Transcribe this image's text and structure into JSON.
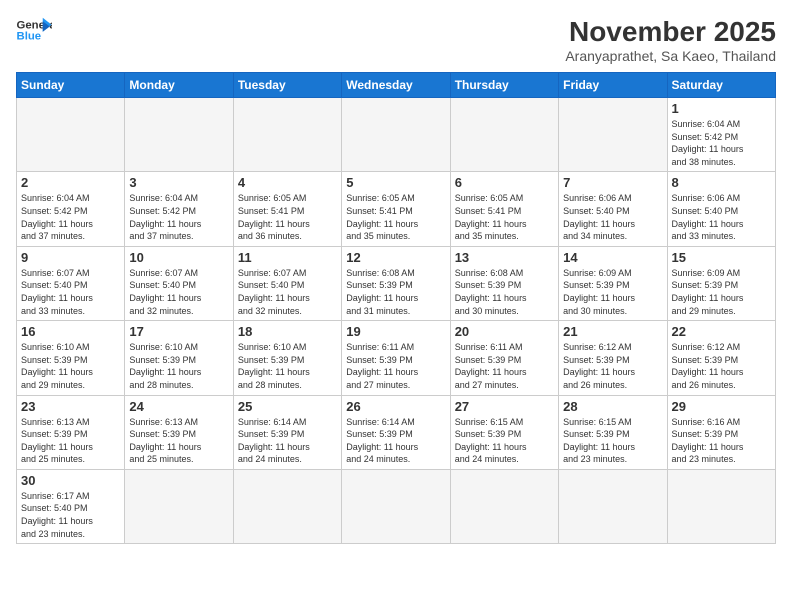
{
  "logo": {
    "line1": "General",
    "line2": "Blue"
  },
  "title": "November 2025",
  "subtitle": "Aranyaprathet, Sa Kaeo, Thailand",
  "weekdays": [
    "Sunday",
    "Monday",
    "Tuesday",
    "Wednesday",
    "Thursday",
    "Friday",
    "Saturday"
  ],
  "weeks": [
    [
      {
        "day": "",
        "info": ""
      },
      {
        "day": "",
        "info": ""
      },
      {
        "day": "",
        "info": ""
      },
      {
        "day": "",
        "info": ""
      },
      {
        "day": "",
        "info": ""
      },
      {
        "day": "",
        "info": ""
      },
      {
        "day": "1",
        "info": "Sunrise: 6:04 AM\nSunset: 5:42 PM\nDaylight: 11 hours\nand 38 minutes."
      }
    ],
    [
      {
        "day": "2",
        "info": "Sunrise: 6:04 AM\nSunset: 5:42 PM\nDaylight: 11 hours\nand 37 minutes."
      },
      {
        "day": "3",
        "info": "Sunrise: 6:04 AM\nSunset: 5:42 PM\nDaylight: 11 hours\nand 37 minutes."
      },
      {
        "day": "4",
        "info": "Sunrise: 6:05 AM\nSunset: 5:41 PM\nDaylight: 11 hours\nand 36 minutes."
      },
      {
        "day": "5",
        "info": "Sunrise: 6:05 AM\nSunset: 5:41 PM\nDaylight: 11 hours\nand 35 minutes."
      },
      {
        "day": "6",
        "info": "Sunrise: 6:05 AM\nSunset: 5:41 PM\nDaylight: 11 hours\nand 35 minutes."
      },
      {
        "day": "7",
        "info": "Sunrise: 6:06 AM\nSunset: 5:40 PM\nDaylight: 11 hours\nand 34 minutes."
      },
      {
        "day": "8",
        "info": "Sunrise: 6:06 AM\nSunset: 5:40 PM\nDaylight: 11 hours\nand 33 minutes."
      }
    ],
    [
      {
        "day": "9",
        "info": "Sunrise: 6:07 AM\nSunset: 5:40 PM\nDaylight: 11 hours\nand 33 minutes."
      },
      {
        "day": "10",
        "info": "Sunrise: 6:07 AM\nSunset: 5:40 PM\nDaylight: 11 hours\nand 32 minutes."
      },
      {
        "day": "11",
        "info": "Sunrise: 6:07 AM\nSunset: 5:40 PM\nDaylight: 11 hours\nand 32 minutes."
      },
      {
        "day": "12",
        "info": "Sunrise: 6:08 AM\nSunset: 5:39 PM\nDaylight: 11 hours\nand 31 minutes."
      },
      {
        "day": "13",
        "info": "Sunrise: 6:08 AM\nSunset: 5:39 PM\nDaylight: 11 hours\nand 30 minutes."
      },
      {
        "day": "14",
        "info": "Sunrise: 6:09 AM\nSunset: 5:39 PM\nDaylight: 11 hours\nand 30 minutes."
      },
      {
        "day": "15",
        "info": "Sunrise: 6:09 AM\nSunset: 5:39 PM\nDaylight: 11 hours\nand 29 minutes."
      }
    ],
    [
      {
        "day": "16",
        "info": "Sunrise: 6:10 AM\nSunset: 5:39 PM\nDaylight: 11 hours\nand 29 minutes."
      },
      {
        "day": "17",
        "info": "Sunrise: 6:10 AM\nSunset: 5:39 PM\nDaylight: 11 hours\nand 28 minutes."
      },
      {
        "day": "18",
        "info": "Sunrise: 6:10 AM\nSunset: 5:39 PM\nDaylight: 11 hours\nand 28 minutes."
      },
      {
        "day": "19",
        "info": "Sunrise: 6:11 AM\nSunset: 5:39 PM\nDaylight: 11 hours\nand 27 minutes."
      },
      {
        "day": "20",
        "info": "Sunrise: 6:11 AM\nSunset: 5:39 PM\nDaylight: 11 hours\nand 27 minutes."
      },
      {
        "day": "21",
        "info": "Sunrise: 6:12 AM\nSunset: 5:39 PM\nDaylight: 11 hours\nand 26 minutes."
      },
      {
        "day": "22",
        "info": "Sunrise: 6:12 AM\nSunset: 5:39 PM\nDaylight: 11 hours\nand 26 minutes."
      }
    ],
    [
      {
        "day": "23",
        "info": "Sunrise: 6:13 AM\nSunset: 5:39 PM\nDaylight: 11 hours\nand 25 minutes."
      },
      {
        "day": "24",
        "info": "Sunrise: 6:13 AM\nSunset: 5:39 PM\nDaylight: 11 hours\nand 25 minutes."
      },
      {
        "day": "25",
        "info": "Sunrise: 6:14 AM\nSunset: 5:39 PM\nDaylight: 11 hours\nand 24 minutes."
      },
      {
        "day": "26",
        "info": "Sunrise: 6:14 AM\nSunset: 5:39 PM\nDaylight: 11 hours\nand 24 minutes."
      },
      {
        "day": "27",
        "info": "Sunrise: 6:15 AM\nSunset: 5:39 PM\nDaylight: 11 hours\nand 24 minutes."
      },
      {
        "day": "28",
        "info": "Sunrise: 6:15 AM\nSunset: 5:39 PM\nDaylight: 11 hours\nand 23 minutes."
      },
      {
        "day": "29",
        "info": "Sunrise: 6:16 AM\nSunset: 5:39 PM\nDaylight: 11 hours\nand 23 minutes."
      }
    ],
    [
      {
        "day": "30",
        "info": "Sunrise: 6:17 AM\nSunset: 5:40 PM\nDaylight: 11 hours\nand 23 minutes."
      },
      {
        "day": "",
        "info": ""
      },
      {
        "day": "",
        "info": ""
      },
      {
        "day": "",
        "info": ""
      },
      {
        "day": "",
        "info": ""
      },
      {
        "day": "",
        "info": ""
      },
      {
        "day": "",
        "info": ""
      }
    ]
  ]
}
